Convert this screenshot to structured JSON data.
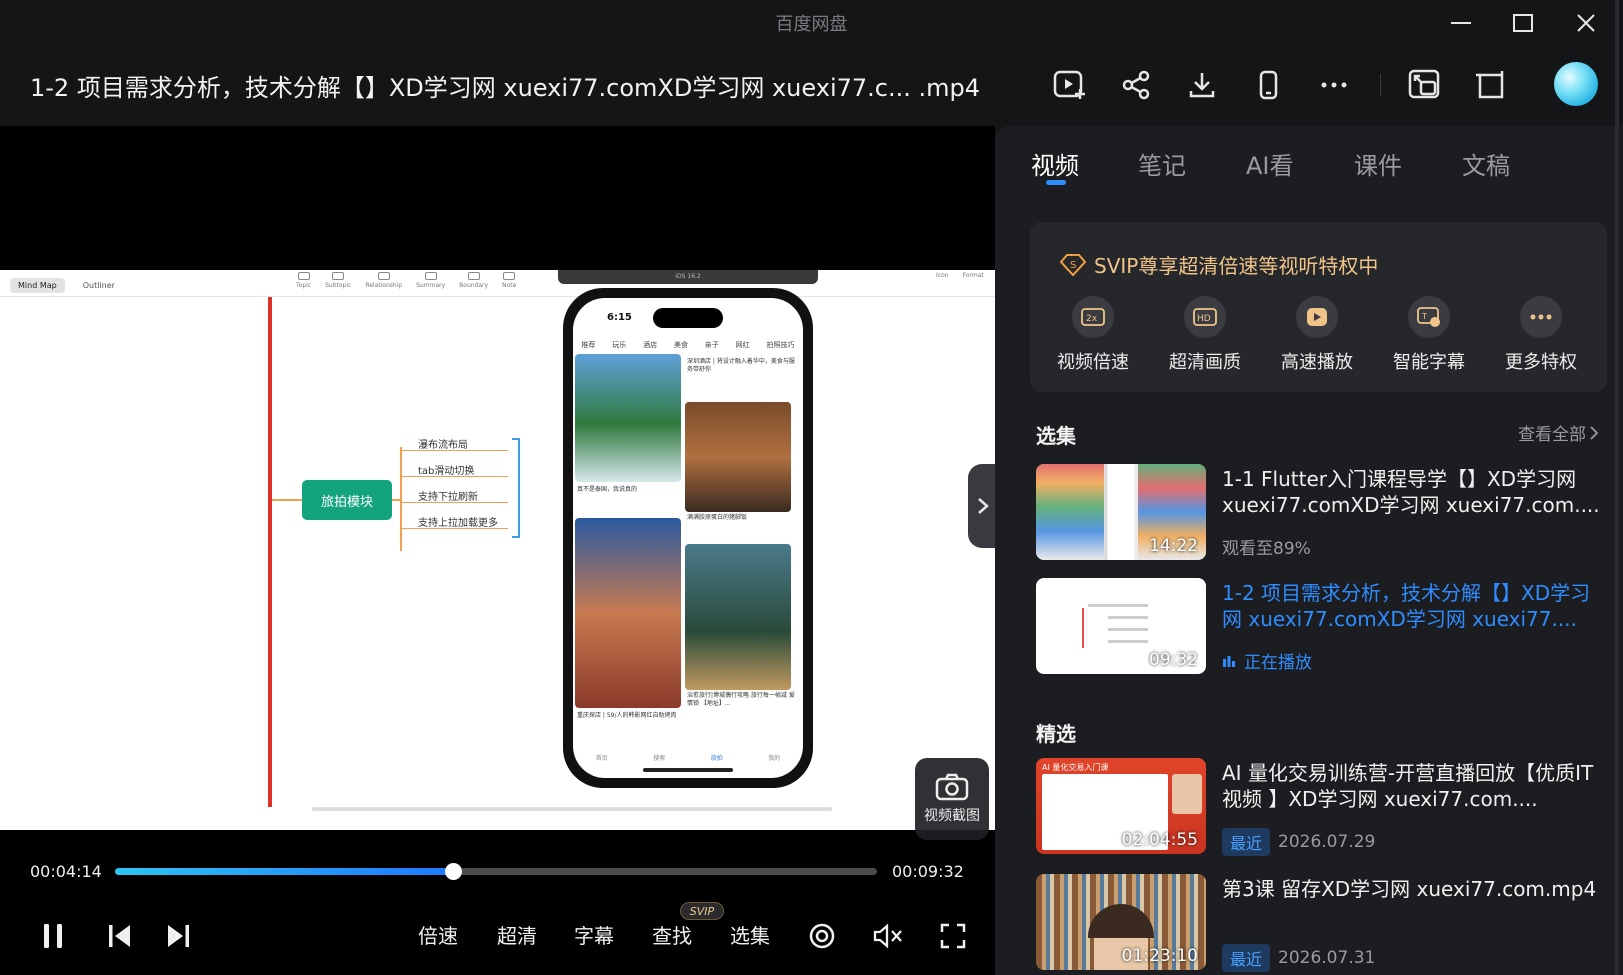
{
  "window": {
    "app_name": "百度网盘",
    "video_title": "1-2 项目需求分析，技术分解【】XD学习网 xuexi77.comXD学习网 xuexi77.c... .mp4"
  },
  "frame": {
    "mindmap_tabs": [
      "Mind Map",
      "Outliner"
    ],
    "mindmap_tools": [
      "Topic",
      "Subtopic",
      "Relationship",
      "Summary",
      "Boundary",
      "Note"
    ],
    "mindmap_right_tools": [
      "Icon",
      "Format"
    ],
    "main_node": "旅拍模块",
    "leaves": [
      "瀑布流布局",
      "tab滑动切换",
      "支持下拉刷新",
      "支持上拉加载更多"
    ],
    "phone": {
      "sim_label": "iOS 16.2",
      "time": "6:15",
      "tabs": [
        "推荐",
        "玩乐",
        "酒店",
        "美食",
        "亲子",
        "网红",
        "拍照技巧"
      ],
      "captions": [
        "深圳酒店 | 将设计融入着华中，美食与服务带舒你",
        "真不是泰国，我说真的",
        "满满胶原蛋白的猪脚饭",
        "重庆探店 | 59/人的韩影网红自助烤肉",
        "治愈旅行|博城偶行攻略 旅行每一帧减 爱情锁 【地址】..."
      ],
      "nav": [
        "首页",
        "搜索",
        "旅拍",
        "我的"
      ]
    },
    "snapshot_label": "视频截图"
  },
  "controls": {
    "current_time": "00:04:14",
    "total_time": "00:09:32",
    "progress": 0.444,
    "speed": "倍速",
    "quality": "超清",
    "subtitle": "字幕",
    "search": "查找",
    "search_badge": "SVIP",
    "episodes": "选集"
  },
  "panel": {
    "tabs": [
      "视频",
      "笔记",
      "AI看",
      "课件",
      "文稿"
    ],
    "active_tab": "视频",
    "svip_title": "SVIP尊享超清倍速等视听特权中",
    "perks": [
      {
        "icon": "speed-2x-icon",
        "label": "视频倍速"
      },
      {
        "icon": "hd-icon",
        "label": "超清画质"
      },
      {
        "icon": "fast-play-icon",
        "label": "高速播放"
      },
      {
        "icon": "ai-subtitle-icon",
        "label": "智能字幕"
      },
      {
        "icon": "more-icon",
        "label": "更多特权"
      }
    ],
    "episodes_title": "选集",
    "see_all": "查看全部",
    "episodes": [
      {
        "title": "1-1 Flutter入门课程导学【】XD学习网 xuexi77.comXD学习网 xuexi77.com....",
        "duration": "14:22",
        "sub": "观看至89%"
      },
      {
        "title": "1-2 项目需求分析，技术分解【】XD学习网 xuexi77.comXD学习网 xuexi77....",
        "duration": "09:32",
        "sub": "正在播放"
      }
    ],
    "featured_title": "精选",
    "featured": [
      {
        "title": "AI 量化交易训练营-开营直播回放【优质IT视频 】XD学习网 xuexi77.com....",
        "duration": "02:04:55",
        "badge": "最近",
        "date": "2026.07.29",
        "thumb_text": "AI 量化交易入门课"
      },
      {
        "title": "第3课 留存XD学习网 xuexi77.com.mp4",
        "duration": "01:23:10",
        "badge": "最近",
        "date": "2026.07.31"
      }
    ],
    "colors": {
      "accent": "#2f8cff",
      "svip_gold": "#f0c489"
    }
  }
}
